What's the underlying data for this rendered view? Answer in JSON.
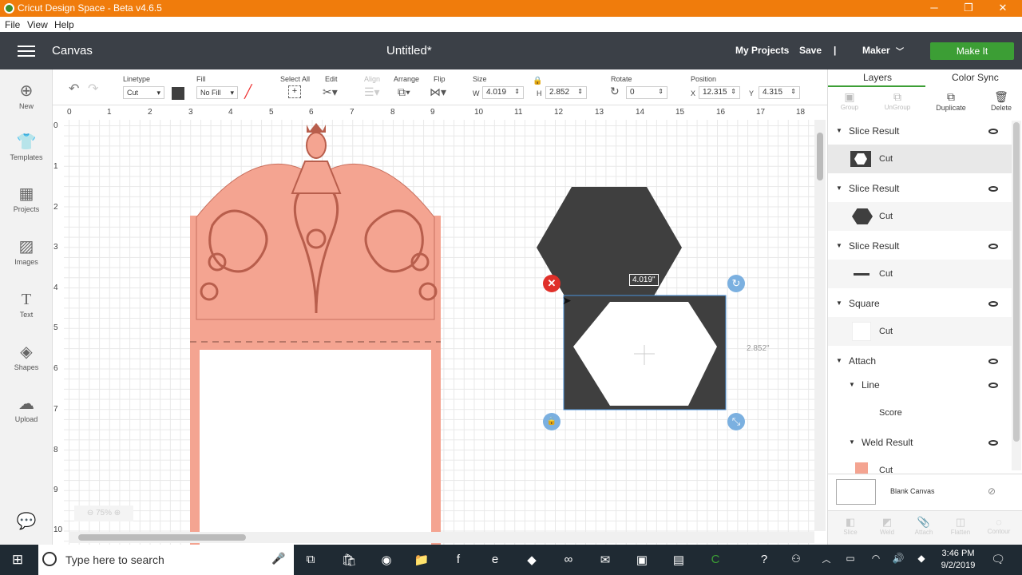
{
  "window": {
    "title": "Cricut Design Space - Beta v4.6.5"
  },
  "menu": [
    "File",
    "View",
    "Help"
  ],
  "header": {
    "section": "Canvas",
    "doc_title": "Untitled*",
    "my_projects": "My Projects",
    "save": "Save",
    "sep": "|",
    "machine": "Maker",
    "make_it": "Make It"
  },
  "left_tools": [
    "New",
    "Templates",
    "Projects",
    "Images",
    "Text",
    "Shapes",
    "Upload"
  ],
  "toolbar": {
    "linetype_label": "Linetype",
    "linetype_value": "Cut",
    "fill_label": "Fill",
    "fill_value": "No Fill",
    "select_all": "Select All",
    "edit": "Edit",
    "align": "Align",
    "arrange": "Arrange",
    "flip": "Flip",
    "size": "Size",
    "w_label": "W",
    "w_value": "4.019",
    "h_label": "H",
    "h_value": "2.852",
    "rotate": "Rotate",
    "rotate_value": "0",
    "position": "Position",
    "x_label": "X",
    "x_value": "12.315",
    "y_label": "Y",
    "y_value": "4.315"
  },
  "ruler": {
    "h": [
      "0",
      "1",
      "2",
      "3",
      "4",
      "5",
      "6",
      "7",
      "8",
      "9",
      "10",
      "11",
      "12",
      "13",
      "14",
      "15",
      "16",
      "17",
      "18"
    ],
    "v": [
      "0",
      "1",
      "2",
      "3",
      "4",
      "5",
      "6",
      "7",
      "8",
      "9",
      "10"
    ]
  },
  "canvas": {
    "width_tag": "4.019\"",
    "height_tag": "2.852\"",
    "zoom": "75%"
  },
  "panel": {
    "tabs": [
      "Layers",
      "Color Sync"
    ],
    "actions": [
      "Group",
      "UnGroup",
      "Duplicate",
      "Delete"
    ],
    "layers": [
      {
        "name": "Slice Result",
        "sub": "Cut"
      },
      {
        "name": "Slice Result",
        "sub": "Cut"
      },
      {
        "name": "Slice Result",
        "sub": "Cut"
      },
      {
        "name": "Square",
        "sub": "Cut"
      },
      {
        "name": "Attach",
        "children": [
          {
            "name": "Line",
            "sub": "Score"
          },
          {
            "name": "Weld Result",
            "sub": "Cut"
          }
        ]
      }
    ],
    "blank_canvas": "Blank Canvas",
    "bottom_actions": [
      "Slice",
      "Weld",
      "Attach",
      "Flatten",
      "Contour"
    ]
  },
  "taskbar": {
    "search": "Type here to search",
    "time": "3:46 PM",
    "date": "9/2/2019"
  },
  "colors": {
    "orange": "#f07c0c",
    "header": "#3b4047",
    "green": "#3c9e35",
    "salmon": "#f4a491",
    "dark": "#3f3f3f"
  }
}
